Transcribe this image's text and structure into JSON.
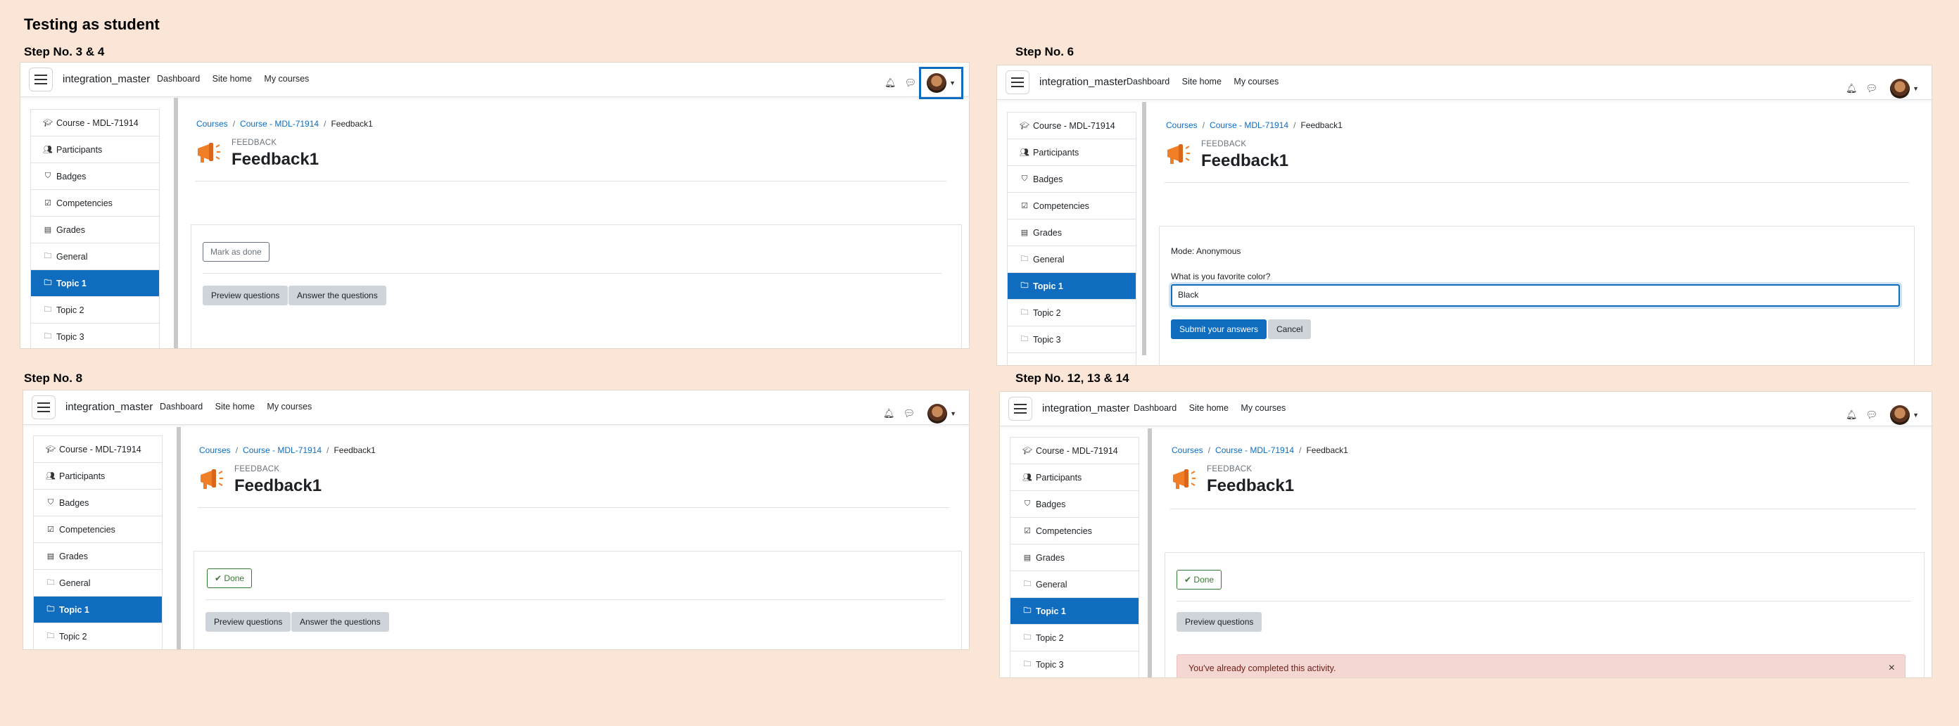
{
  "page_title": "Testing as student",
  "common": {
    "brand": "integration_master",
    "nav": [
      "Dashboard",
      "Site home",
      "My courses"
    ],
    "sidebar": [
      "Course - MDL-71914",
      "Participants",
      "Badges",
      "Competencies",
      "Grades",
      "General",
      "Topic 1",
      "Topic 2",
      "Topic 3"
    ],
    "breadcrumb": [
      "Courses",
      "Course - MDL-71914",
      "Feedback1"
    ],
    "activity_type": "FEEDBACK",
    "activity_name": "Feedback1",
    "colors": {
      "background": "#fbe5d6",
      "primary": "#0f6cbf",
      "success": "#357a32",
      "alert_bg": "#f4d6d2"
    }
  },
  "steps": {
    "s1": {
      "label": "Step No. 3 & 4",
      "mark_done": "Mark as done",
      "preview": "Preview questions",
      "answer": "Answer the questions"
    },
    "s2": {
      "label": "Step No. 6",
      "mode": "Mode: Anonymous",
      "question": "What is you favorite color?",
      "answer_value": "Black",
      "submit": "Submit your answers",
      "cancel": "Cancel"
    },
    "s3": {
      "label": "Step No. 8",
      "done": "Done",
      "preview": "Preview questions",
      "answer": "Answer the questions"
    },
    "s4": {
      "label": "Step No. 12, 13 & 14",
      "done": "Done",
      "preview": "Preview questions",
      "alert": "You've already completed this activity.",
      "alert_close": "×"
    }
  },
  "icons": {
    "check": "✔",
    "close": "×",
    "course": "graduation-cap-icon",
    "users": "users-icon",
    "shield": "shield-icon",
    "check-square": "check-square-icon",
    "table": "table-icon",
    "folder": "folder-icon",
    "megaphone": "megaphone-icon"
  }
}
